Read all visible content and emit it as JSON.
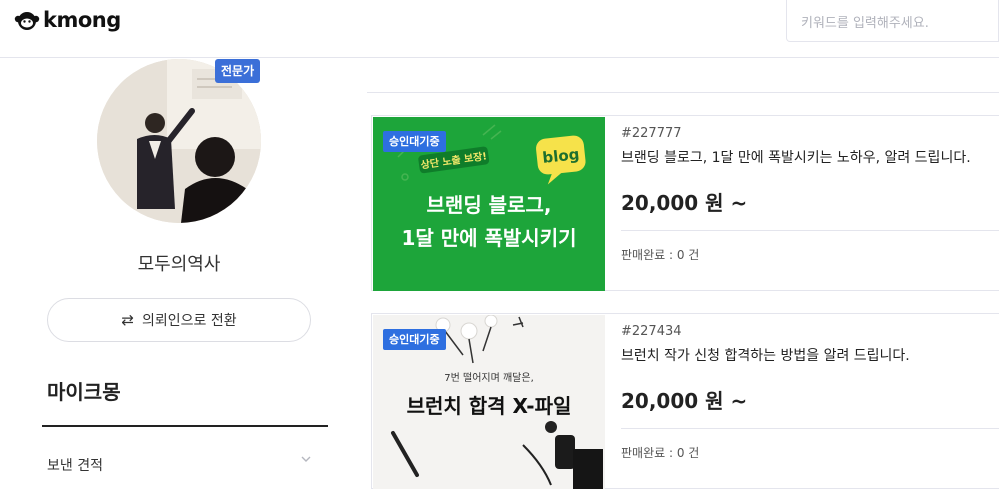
{
  "header": {
    "logo_text": "kmong",
    "search_placeholder": "키워드를 입력해주세요."
  },
  "profile": {
    "badge": "전문가",
    "name": "모두의역사",
    "switch_icon": "⇄",
    "switch_label": "의뢰인으로 전환"
  },
  "sidebar": {
    "section_title": "마이크몽",
    "items": [
      {
        "label": "보낸 견적",
        "icon": "chevron-down-icon"
      }
    ]
  },
  "gigs": [
    {
      "status": "승인대기중",
      "id": "#227777",
      "title": "브랜딩 블로그, 1달 만에 폭발시키는 노하우, 알려 드립니다.",
      "price": "20,000 원 ~",
      "sold": "판매완료 : 0 건",
      "thumb": {
        "ribbon": "상단 노출 보장!",
        "bubble": "blog",
        "line1": "브랜딩 블로그,",
        "line2": "1달 만에 폭발시키기",
        "bg": "#1da53a"
      }
    },
    {
      "status": "승인대기중",
      "id": "#227434",
      "title": "브런치 작가 신청 합격하는 방법을 알려 드립니다.",
      "price": "20,000 원 ~",
      "sold": "판매완료 : 0 건",
      "thumb": {
        "subtitle": "7번 떨어지며 깨달은,",
        "headline": "브런치 합격 X-파일",
        "bg": "#f4f3f1"
      }
    }
  ]
}
